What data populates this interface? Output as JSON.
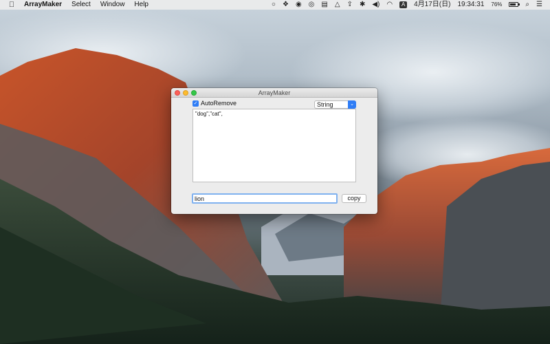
{
  "menubar": {
    "app_name": "ArrayMaker",
    "menus": [
      "Select",
      "Window",
      "Help"
    ],
    "battery_percent": "76%",
    "battery_level": 0.76,
    "date": "4月17日(日)",
    "time": "19:34:31",
    "ime_label": "A",
    "tray_icons": [
      "sync-icon",
      "dropbox-icon",
      "app-icon",
      "broadcast-icon",
      "clipboard-icon",
      "drive-icon",
      "upload-icon",
      "bluetooth-icon",
      "volume-icon",
      "wifi-icon"
    ]
  },
  "window": {
    "title": "ArrayMaker",
    "auto_remove_label": "AutoRemove",
    "auto_remove_checked": true,
    "type_selected": "String",
    "output_text": "\"dog\",\"cat\",",
    "input_value": "lion",
    "copy_label": "copy"
  },
  "colors": {
    "accent": "#2f7df6",
    "close": "#fc5f57",
    "minimize": "#fdbc2e",
    "maximize": "#33c748"
  }
}
